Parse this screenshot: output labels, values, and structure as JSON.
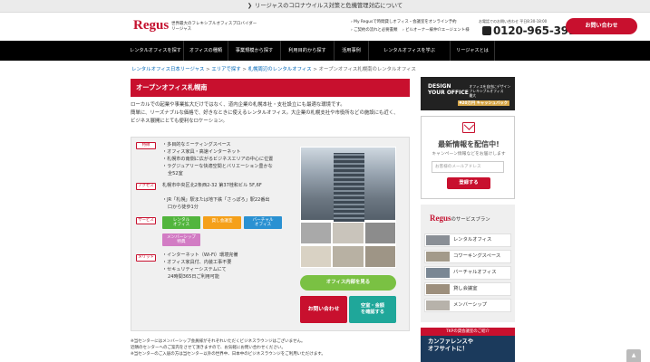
{
  "announcement": {
    "arrow": "❯",
    "text": "リージャスのコロナウイルス対策と危機管理対応について"
  },
  "header": {
    "logo": "Regus",
    "tagline_1": "世界最大のフレキシブルオフィスプロバイダー",
    "tagline_2": "リージャス",
    "links": [
      "› My Regusで時間貸しオフィス・会議室をオンライン予約",
      "› ご契約の流れと必要書類",
      "› ビルオーナー様",
      "› 仲介エージェント様"
    ],
    "phone_label": "お電話でのお問い合わせ  平日8:30-18:00",
    "phone": "0120-965-391",
    "contact_button": "お問い合わせ"
  },
  "nav": {
    "items": [
      "レンタルオフィスを探す",
      "オフィスの種類",
      "事業規模から探す",
      "利用目的から探す",
      "活用事例",
      "レンタルオフィスを学ぶ",
      "リージャスとは"
    ]
  },
  "breadcrumb": {
    "items": [
      "レンタルオフィス日本リージャス",
      "エリアで探す",
      "札幌周辺のレンタルオフィス"
    ],
    "separator": ">",
    "current": "オープンオフィス札幌南のレンタルオフィス"
  },
  "center": {
    "title": "オープンオフィス札幌南",
    "intro": [
      "ローカルでの起業や事業拡大だけではなく、道内企業の札幌本社・支社設立にも最適な環境です。",
      "簡単に、リーズナブルな価格で、好きなときに使えるレンタルオフィス。大企業の札幌支社や市役所などの施設にも近く、",
      "ビジネス展開にとても便利なロケーション。"
    ],
    "features_tag": "特徴",
    "features": [
      "多目的なミーティングスペース",
      "オフィス家具・高速インターネット",
      "札幌市の南側に広がるビジネスエリアの中心に位置",
      "ラグジュアリーな快適空間とバリエーション豊かな",
      "全52室"
    ],
    "access_tag": "アクセス",
    "address": "札幌市中央区北2条西2-32 第37桂和ビル 5F,6F",
    "access_lines": [
      "JR「札幌」駅または地下鉄「さっぽろ」駅22番出",
      "口から徒歩1分"
    ],
    "services_tag": "サービス",
    "services": [
      {
        "line1": "レンタル",
        "line2": "オフィス",
        "color": "#52b53d"
      },
      {
        "line1": "貸し会議室",
        "line2": "",
        "color": "#f5a01a"
      },
      {
        "line1": "バーチャル",
        "line2": "オフィス",
        "color": "#2a91d2"
      },
      {
        "line1": "メンバーシップ",
        "line2": "特典",
        "color": "#d27cc4"
      }
    ],
    "merit_tag": "メリット",
    "merits": [
      "インターネット（Wi-Fi）環境完備",
      "オフィス家具付、内装工事不要",
      "セキュリティーシステムにて",
      "24時間365日ご利用可能"
    ],
    "tour_button": "オフィス内部を見る",
    "inquiry_button": "お問い合わせ",
    "vacancy_line1": "空室・金額",
    "vacancy_line2": "を確認する",
    "notes": [
      "※当センターにはメンバーシップ会員様がそれぞれいただくビジネスラウンジはございません。",
      "近隣のセンターへのご案内をさせて頂きますので、お気軽にお問い合わせください。",
      "※当センターのご入居の方は当センター以外の世界中、日本中のビジネスラウンジをご利用いただけます。"
    ]
  },
  "sidebar": {
    "banner_big_1": "DESIGN",
    "banner_big_2": "YOUR OFFICE",
    "banner_sub_1": "オフィスを自由にデザイン",
    "banner_sub_2": "フレキシブルオフィス",
    "banner_sub_3": "最大",
    "banner_gold": "¥20万円",
    "banner_gold_sub": "キャッシュバック",
    "newsletter_title": "最新情報を配信中!",
    "newsletter_sub": "キャンペーン情報などをお届けします",
    "newsletter_placeholder": "お客様のメールアドレス",
    "newsletter_button": "登録する",
    "plans_brand": "Regus",
    "plans_title": "のサービスプラン",
    "plans": [
      "レンタルオフィス",
      "コワーキングスペース",
      "バーチャルオフィス",
      "貸し会議室",
      "メンバーシップ"
    ],
    "tkp_header": "TKPの貸会議室のご紹介",
    "tkp_line1": "カンファレンスや",
    "tkp_line2": "オフサイトに！"
  },
  "scroll_top": "▲"
}
